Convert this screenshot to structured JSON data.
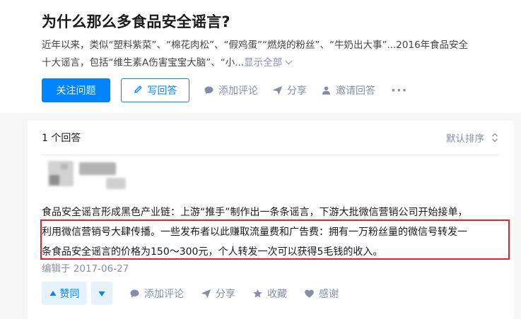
{
  "question": {
    "title": "为什么那么多食品安全谣言?",
    "detail_line1": "近年以来，类似“塑料紫菜”、“棉花肉松”、“假鸡蛋”“燃烧的粉丝”、“牛奶出大事”...2016年食品安全",
    "detail_line2": "十大谣言，包括“维生素A伤害宝宝大脑”、“小...",
    "show_all": "显示全部",
    "actions": {
      "follow": "关注问题",
      "write_answer": "写回答",
      "add_comment": "添加评论",
      "share": "分享",
      "invite": "邀请回答",
      "more": "···"
    }
  },
  "answers": {
    "count_label": "1 个回答",
    "sort_label": "默认排序",
    "answer": {
      "line1": "食品安全谣言形成黑色产业链：上游“推手”制作出一条条谣言，下游大批微信营销公司开始接单，",
      "line2": "利用微信营销号大肆传播。一些发布者以此赚取流量费和广告费：拥有一万粉丝量的微信号转发一",
      "line3": "条食品安全谣言的价格为150～300元，个人转发一次可以获得5毛钱的收入。",
      "edited": "编辑于 2017-06-27",
      "actions": {
        "upvote": "赞同",
        "add_comment": "添加评论",
        "share": "分享",
        "favorite": "收藏",
        "thanks": "感谢"
      }
    }
  },
  "colors": {
    "brand": "#0084ff",
    "meta": "#8590a6",
    "highlight": "#e8202c"
  }
}
